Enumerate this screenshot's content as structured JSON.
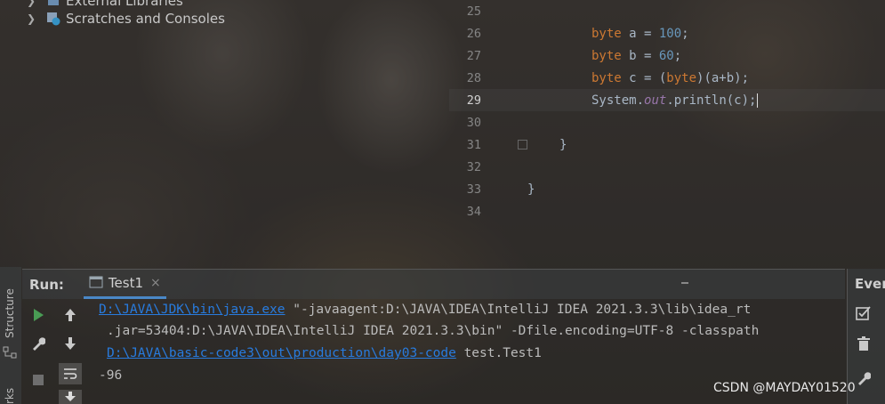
{
  "project_tree": {
    "items": [
      {
        "label": "External Libraries"
      },
      {
        "label": "Scratches and Consoles"
      }
    ]
  },
  "editor": {
    "line_numbers": [
      "25",
      "26",
      "27",
      "28",
      "29",
      "30",
      "31",
      "32",
      "33",
      "34"
    ],
    "current_line": "29",
    "code": {
      "l26_kw": "byte",
      "l26_rest": " a = ",
      "l26_num": "100",
      "l26_end": ";",
      "l27_kw": "byte",
      "l27_rest": " b = ",
      "l27_num": "60",
      "l27_end": ";",
      "l28_kw": "byte",
      "l28_mid": " c = (",
      "l28_kw2": "byte",
      "l28_end": ")(a+b);",
      "l29_a": "System.",
      "l29_fld": "out",
      "l29_b": ".println(c);",
      "l31": "}",
      "l33": "}"
    }
  },
  "run_panel": {
    "label": "Run:",
    "tab_label": "Test1",
    "tab_close": "×",
    "console": {
      "line1_link": "D:\\JAVA\\JDK\\bin\\java.exe",
      "line1_rest": " \"-javaagent:D:\\JAVA\\IDEA\\IntelliJ IDEA 2021.3.3\\lib\\idea_rt",
      "line2": ".jar=53404:D:\\JAVA\\IDEA\\IntelliJ IDEA 2021.3.3\\bin\" -Dfile.encoding=UTF-8 -classpath",
      "line3_link": "D:\\JAVA\\basic-code3\\out\\production\\day03-code",
      "line3_rest": " test.Test1",
      "output": "-96"
    }
  },
  "left_strip": {
    "structure": "Structure",
    "bookmarks": "rks"
  },
  "right_panel": {
    "title": "Even"
  },
  "watermark": "CSDN @MAYDAY01520",
  "colors": {
    "keyword": "#cc7832",
    "number": "#6897bb",
    "field": "#9876aa",
    "link": "#287bde",
    "run_green": "#499c54"
  },
  "icons": [
    "chevron-right-icon",
    "external-libraries-icon",
    "scratches-icon",
    "console-tab-icon",
    "run-icon",
    "rerun-up-icon",
    "scroll-down-icon",
    "wrench-icon",
    "stop-icon",
    "soft-wrap-icon",
    "scroll-to-end-icon",
    "event-log-check-icon",
    "trash-icon",
    "settings-wrench-icon",
    "fold-marker-icon"
  ]
}
